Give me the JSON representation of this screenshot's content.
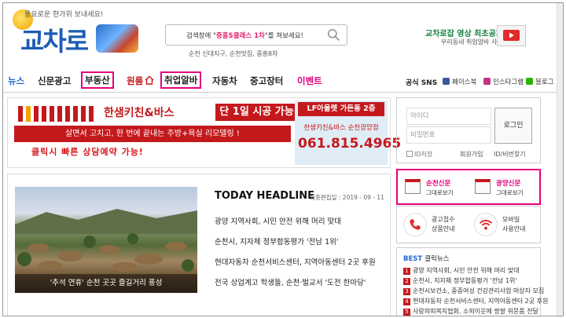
{
  "header": {
    "logo_tagline": "풍요로운 한가위 보내세요!",
    "logo_text": "교차로",
    "search_prefix": "검색창에 \"",
    "search_highlight": "중흥S클래스 1차",
    "search_suffix": "\"를 쳐보세요!",
    "search_tags": "순천 신대지구, 순천맛집, 중흥8차",
    "promo_title": "교차로잡 영상 최초공개!",
    "promo_sub": "우리동네 취업알바 사이트!"
  },
  "nav": {
    "items": [
      "뉴스",
      "신문광고",
      "부동산",
      "원룸",
      "취업알바",
      "자동차",
      "중고장터",
      "이벤트"
    ],
    "sns_label": "공식 SNS",
    "sns": [
      "페이스북",
      "인스타그램",
      "블로그"
    ]
  },
  "banner": {
    "brand": "한샘키친&바스",
    "brand_tag": "단 1일 시공 가능",
    "line": "살면서 고치고, 한 번에 끝내는 주방+욕실 리모델링 !",
    "call": "클릭시 빠른 상담예약 가능!",
    "outlet_tag": "LF아울렛 가든동 2층",
    "outlet_name": "한샘키친&바스 순천광양점",
    "outlet_phone": "061.815.4965"
  },
  "login": {
    "id_placeholder": "아이디",
    "pw_placeholder": "비밀번호",
    "button": "로그인",
    "save_id": "ID저장",
    "join": "회원가입",
    "find": "ID/비번찾기"
  },
  "today": {
    "title": "TODAY HEADLINE",
    "date": "최종편집일 : 2019 - 09 - 11",
    "photo_caption": "'추석 연휴' 순천 곳곳 즐길거리 풍성",
    "headlines": [
      "광양 지역사회, 시민 안전 위해 머리 맞대",
      "순천시, 지자체 정부합동평가 '전남 1위'",
      "현대자동차 순천서비스센터, 지역아동센터 2곳 후원",
      "전국 상업계고 학생들, 순천·벌교서 '도전 한마당'"
    ]
  },
  "papers": [
    {
      "title": "순천신문",
      "sub": "그대로보기"
    },
    {
      "title": "광양신문",
      "sub": "그대로보기"
    }
  ],
  "services": [
    {
      "line1": "광고접수",
      "line2": "상품안내"
    },
    {
      "line1": "모바일",
      "line2": "사용안내"
    }
  ],
  "best": {
    "label": "BEST",
    "title": "클릭뉴스",
    "items": [
      "광양 지역사회, 시민 안전 위해 머리 맞대",
      "순천시, 지자체 정부합동평가 '전남 1위'",
      "순천시보건소, 중증여성 건강관리사업 머상자 모집",
      "현대자동차 순천서비스센터, 지역아동센터 2곳 후원",
      "사랑의띠복지협회, 소외이웃에 쌍쌀 위문품 전달"
    ]
  },
  "colors": {
    "brand_blue": "#1e5cb3",
    "magenta": "#e6007e",
    "banner_red": "#c4191c"
  }
}
